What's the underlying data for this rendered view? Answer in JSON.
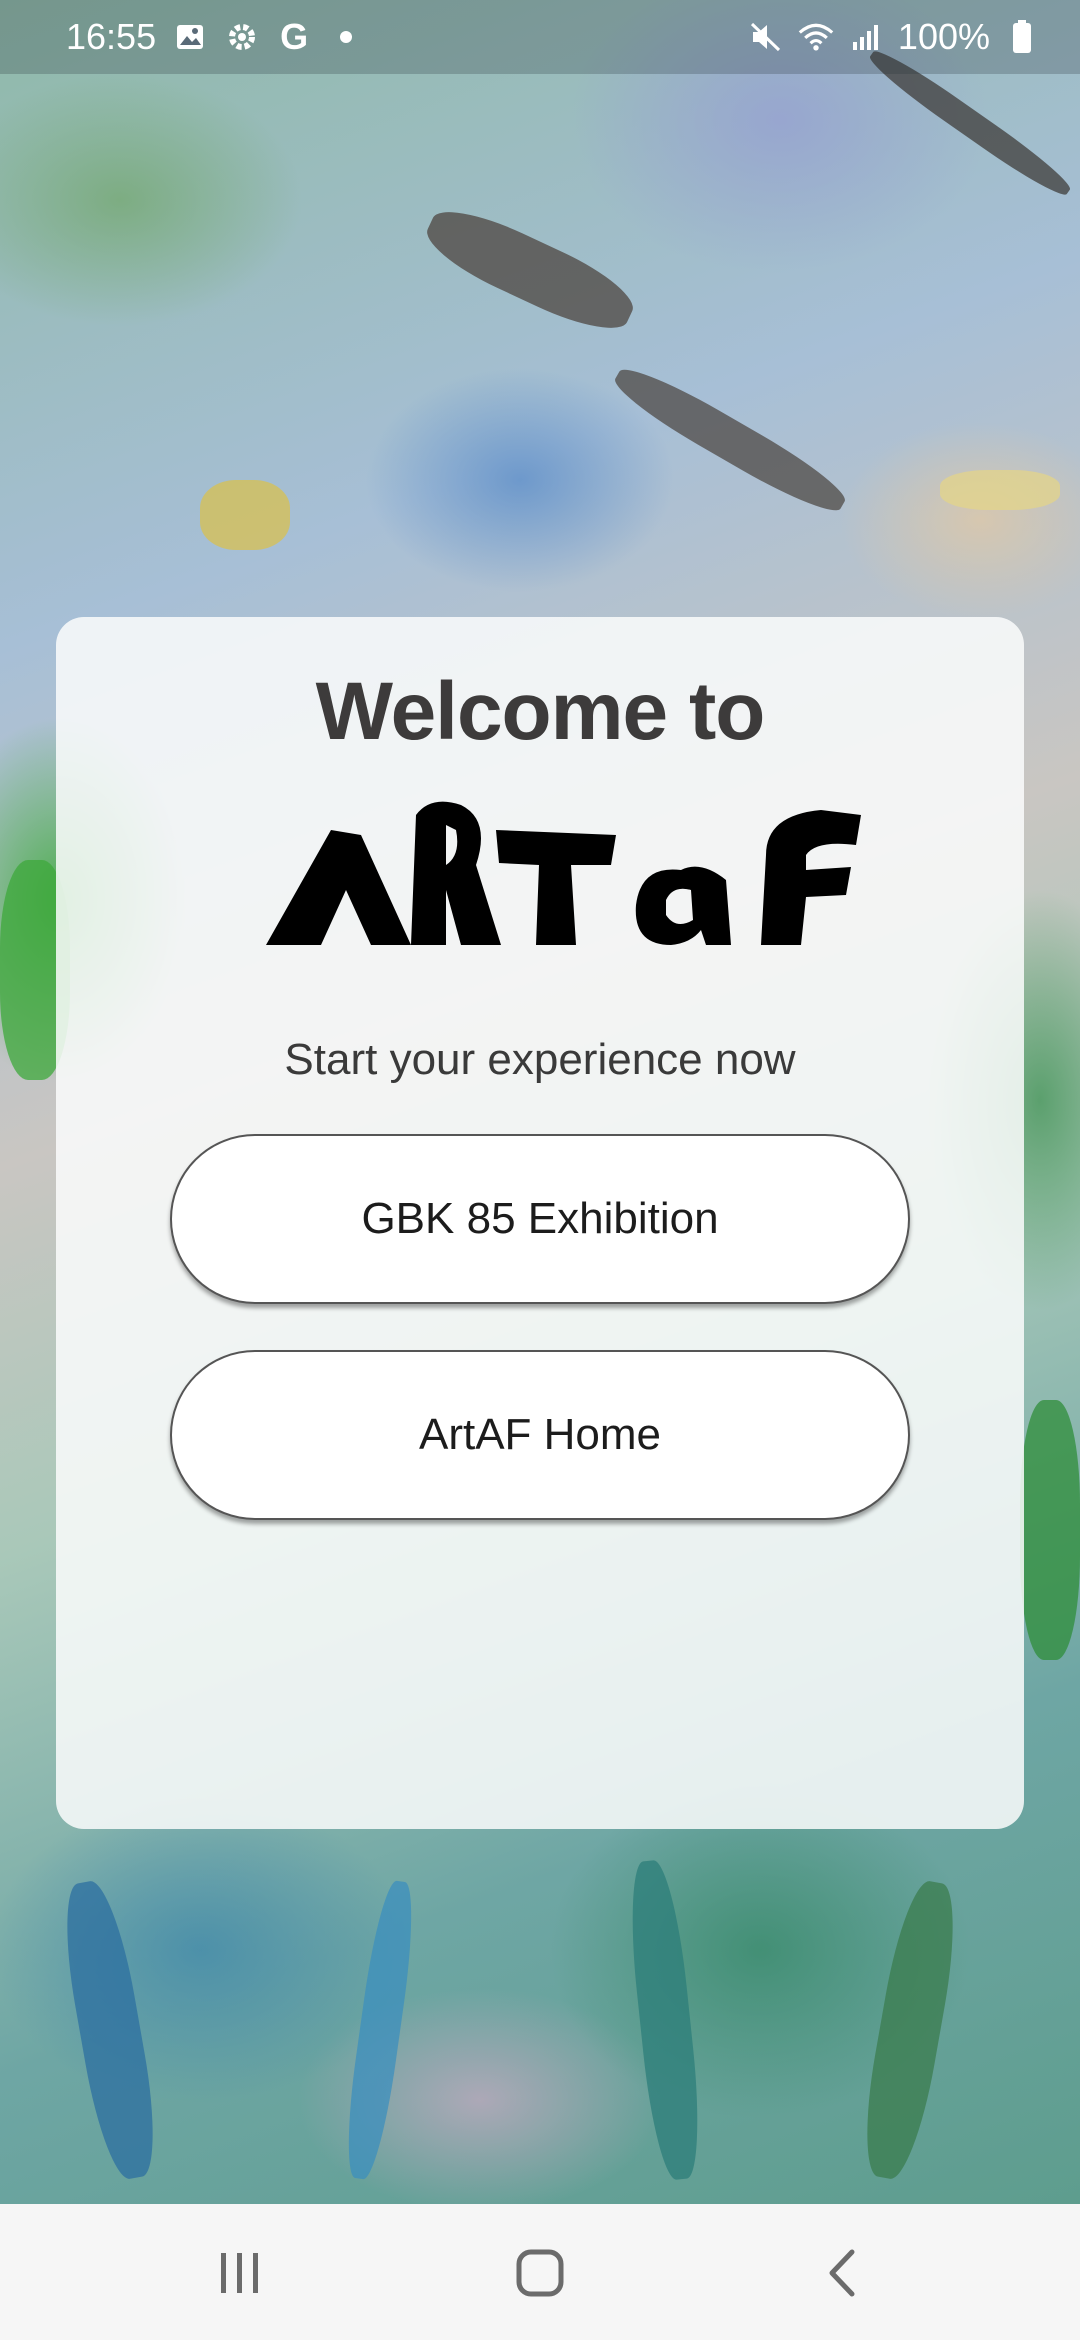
{
  "status_bar": {
    "time": "16:55",
    "battery": "100%",
    "left_icons": [
      "gallery-icon",
      "settings-gear-icon",
      "google-g-icon",
      "notification-dot-icon"
    ],
    "right_icons": [
      "mute-icon",
      "wifi-icon",
      "signal-icon",
      "battery-icon"
    ]
  },
  "card": {
    "welcome_text": "Welcome to",
    "logo_text": "ARTaf",
    "subtitle": "Start your experience now"
  },
  "buttons": {
    "exhibition_label": "GBK 85 Exhibition",
    "home_label": "ArtAF Home"
  },
  "navbar": {
    "icons": [
      "recent-apps-icon",
      "home-icon",
      "back-icon"
    ]
  },
  "colors": {
    "card_bg": "#fafcfc",
    "button_bg": "#ffffff",
    "button_border": "#555555",
    "heading_text": "#3d3b3b",
    "navbar_bg": "#f6f6f6"
  }
}
